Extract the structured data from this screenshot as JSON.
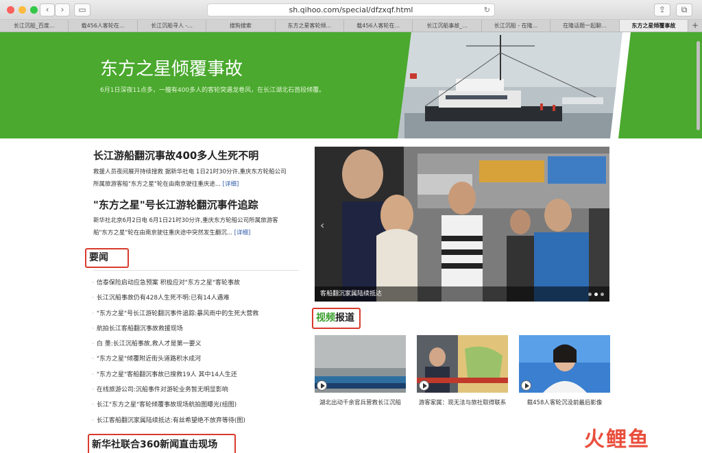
{
  "browser": {
    "url": "sh.qihoo.com/special/dfzxqf.html",
    "tabs": [
      "长江沉船_百度...",
      "载456人客轮在...",
      "长江沉船寻人 -...",
      "搜狗搜索",
      "东方之星客轮倾...",
      "载456人客轮在...",
      "长江沉船事故_...",
      "长江沉船 - 在隆...",
      "在隆话题一起聊...",
      "东方之星倾覆事故"
    ]
  },
  "banner": {
    "title": "东方之星倾覆事故",
    "subtitle": "6月1日深夜11点多，一艘有400多人的客轮突遇龙卷风，在长江湖北石首段倾覆。"
  },
  "stories": [
    {
      "title": "长江游船翻沉事故400多人生死不明",
      "summary_line1": "救援人员夜间展开持续搜救 据新华社电 1日21时30分许,重庆东方轮船公司",
      "summary_line2": "所属旅游客船\"东方之星\"轮在由南京驶往重庆途...",
      "more": "[详细]"
    },
    {
      "title": "\"东方之星\"号长江游轮翻沉事件追踪",
      "summary_line1": "新华社北京6月2日电 6月1日21时30分许,重庆东方轮船公司所属旅游客",
      "summary_line2": "船\"东方之星\"轮在由南京驶往重庆途中突然发生翻沉...",
      "more": "[详细]"
    }
  ],
  "sections": {
    "news": "要闻",
    "video_a": "视频",
    "video_b": "报道",
    "live": "新华社联合360新闻直击现场"
  },
  "news_items": [
    "信泰保险启动应急预案 积极应对\"东方之星\"客轮事故",
    "长江沉船事故仍有428人生死不明:已有14人遇难",
    "\"东方之星\"号长江游轮翻沉事件追踪:暴风雨中的生死大营救",
    "航拍长江客船翻沉事故救援现场",
    "白 墨:长江沉船事故,救人才是第一要义",
    "\"东方之星\"倾覆附近街头道路积水成河",
    "\"东方之星\"客船翻沉事故已搜救19人 其中14人生还",
    "在线旅游公司:沉船事件对游轮业务暂无明显影响",
    "长江\"东方之星\"客轮倾覆事故现场航拍图曝光(组图)",
    "长江客船翻沉家属陆续抵达:有丝希望绝不放弃等待(图)"
  ],
  "main_photo": {
    "caption": "客船翻沉家属陆续抵达"
  },
  "videos": [
    {
      "caption": "湖北出动千余官兵营救长江沉船"
    },
    {
      "caption": "游客家属：现无法与旅社取得联系"
    },
    {
      "caption": "载458人客轮沉没前最后影像"
    }
  ],
  "watermark": {
    "c1": "火",
    "c2": "鲤",
    "c3": "鱼"
  },
  "colors": {
    "banner_green": "#4aa92e",
    "highlight_red": "#d83a2c",
    "video_green": "#3a9f2c"
  }
}
